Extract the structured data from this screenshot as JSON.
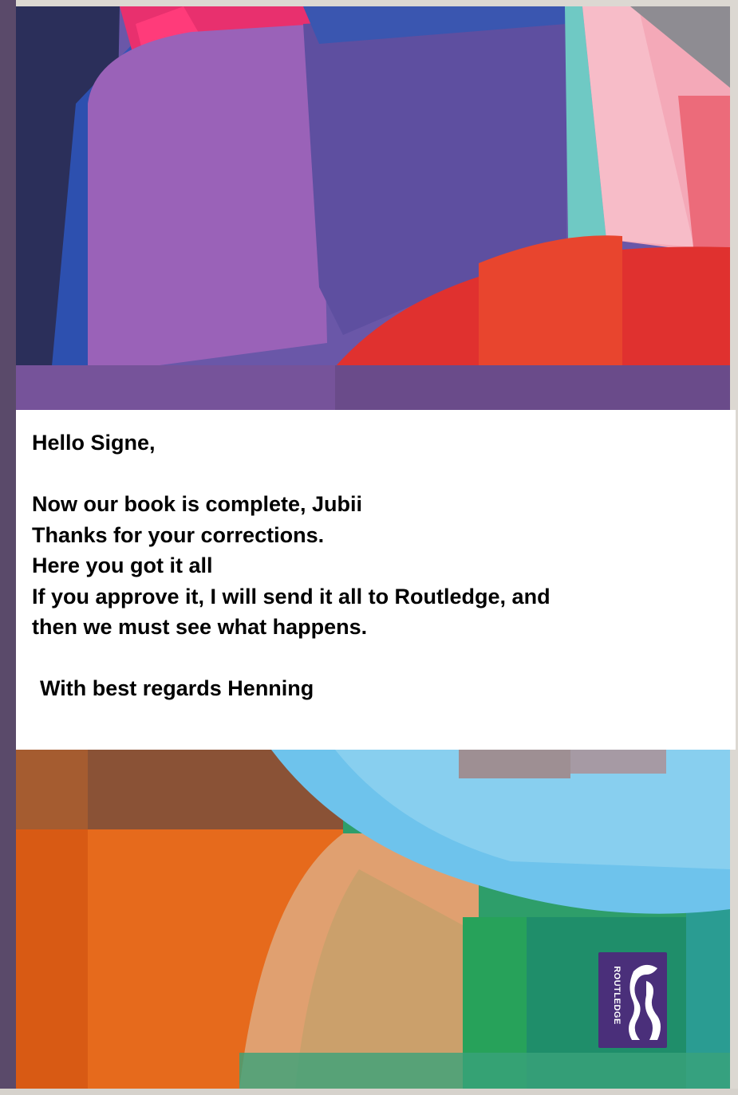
{
  "note": {
    "greeting": "Hello Signe,",
    "lines": [
      "Now our book is complete, Jubii",
      "Thanks for your corrections.",
      "Here you got it all",
      "If you approve it, I will send it all to Routledge, and",
      "then we must see what happens."
    ],
    "signoff": "With best regards Henning"
  },
  "logo": {
    "text": "ROUTLEDGE",
    "icon": "routledge-profile-icon"
  },
  "colors": {
    "note_background": "#ffffff",
    "note_text": "#000000",
    "logo_background": "#4a2f7a",
    "cover_purple": "#7a4fa6",
    "cover_red": "#d6302b",
    "cover_orange": "#e8701c",
    "cover_sky": "#6ec3ec",
    "cover_green": "#2e9e6a"
  }
}
